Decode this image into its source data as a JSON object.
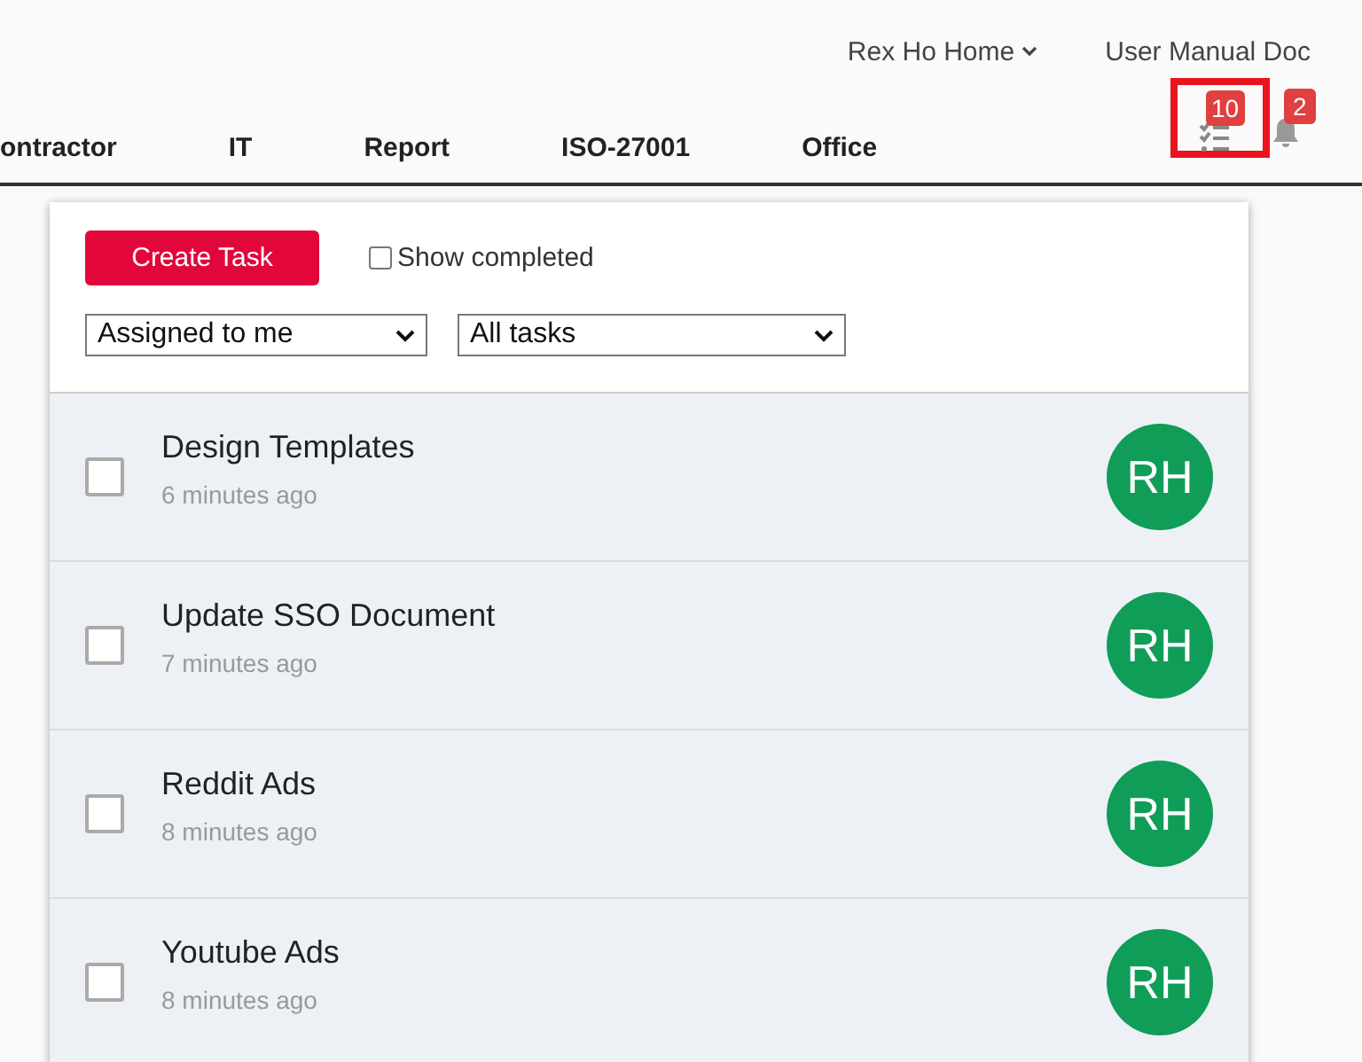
{
  "top_links": [
    {
      "label": "Rex Ho Home",
      "dropdown": true
    },
    {
      "label": "User Manual Doc",
      "dropdown": false
    }
  ],
  "nav": [
    {
      "label": "ontractor"
    },
    {
      "label": "IT"
    },
    {
      "label": "Report"
    },
    {
      "label": "ISO-27001"
    },
    {
      "label": "Office"
    }
  ],
  "task_button": {
    "badge": "10",
    "highlighted": true
  },
  "notifications": {
    "badge": "2"
  },
  "task_panel": {
    "create_button": "Create Task",
    "show_completed": {
      "label": "Show completed",
      "checked": false
    },
    "filters": [
      {
        "value": "Assigned to me"
      },
      {
        "value": "All tasks"
      }
    ],
    "tasks": [
      {
        "title": "Design Templates",
        "time": "6 minutes ago",
        "checked": false,
        "avatar": "RH"
      },
      {
        "title": "Update SSO Document",
        "time": "7 minutes ago",
        "checked": false,
        "avatar": "RH"
      },
      {
        "title": "Reddit Ads",
        "time": "8 minutes ago",
        "checked": false,
        "avatar": "RH"
      },
      {
        "title": "Youtube Ads",
        "time": "8 minutes ago",
        "checked": false,
        "avatar": "RH"
      }
    ]
  }
}
